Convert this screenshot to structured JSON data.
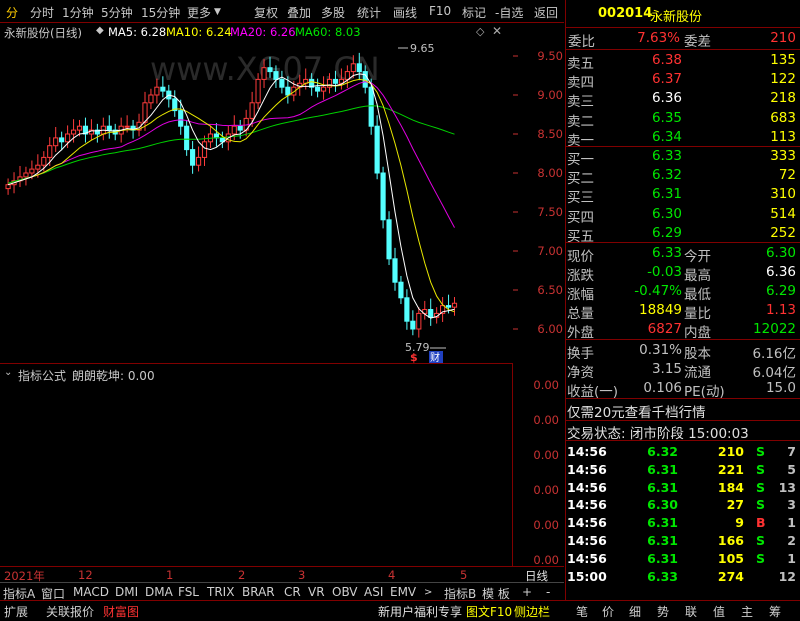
{
  "toolbar": {
    "first_glyph": "分",
    "items": [
      "分时",
      "1分钟",
      "5分钟",
      "15分钟",
      "更多"
    ],
    "right_items": [
      "复权",
      "叠加",
      "多股",
      "统计",
      "画线",
      "F10",
      "标记",
      "-自选",
      "返回"
    ]
  },
  "chart": {
    "stock_name": "永新股份(日线)",
    "ma_labels": [
      {
        "text": "MA5: 6.28",
        "color": "#ffffff"
      },
      {
        "text": "MA10: 6.24",
        "color": "#ffff00"
      },
      {
        "text": "MA20: 6.26",
        "color": "#ff00ff"
      },
      {
        "text": "MA60: 8.03",
        "color": "#00e600"
      }
    ],
    "high_marker": "9.65",
    "low_marker": "5.79",
    "event_marks": [
      "$",
      "财"
    ],
    "price_axis": [
      "9.50",
      "9.00",
      "8.50",
      "8.00",
      "7.50",
      "7.00",
      "6.50",
      "6.00"
    ],
    "indicator_title": "指标公式",
    "indicator_name": "朗朗乾坤: 0.00",
    "indicator_axis": [
      "0.00",
      "0.00",
      "0.00",
      "0.00",
      "0.00",
      "0.00"
    ],
    "dates": [
      "2021年",
      "12",
      "1",
      "2",
      "3",
      "4",
      "5"
    ],
    "period": "日线",
    "watermark": "www.XG07.CN"
  },
  "chart_data": {
    "type": "candlestick",
    "ylim": [
      5.6,
      9.75
    ],
    "ma_values": {
      "MA5": 6.28,
      "MA10": 6.24,
      "MA20": 6.26,
      "MA60": 8.03
    },
    "high": 9.65,
    "low": 5.79
  },
  "tabs": {
    "items": [
      "指标A",
      "窗口",
      "MACD",
      "DMI",
      "DMA",
      "FSL",
      "TRIX",
      "BRAR",
      "CR",
      "VR",
      "OBV",
      "ASI",
      "EMV"
    ],
    "right": [
      "指标B",
      "模 板",
      "+",
      "-"
    ]
  },
  "bottom": {
    "left": [
      "扩展",
      "关联报价",
      "财富图"
    ],
    "promo": "新用户福利专享",
    "f10": "图文F10",
    "side": "侧边栏",
    "right": [
      "笔",
      "价",
      "细",
      "势",
      "联",
      "值",
      "主",
      "筹"
    ]
  },
  "quote": {
    "code": "002014",
    "name": "永新股份",
    "weibi_label": "委比",
    "weibi": "7.63%",
    "weicha_label": "委差",
    "weicha": "210",
    "sells": [
      {
        "label": "卖五",
        "price": "6.38",
        "vol": "135"
      },
      {
        "label": "卖四",
        "price": "6.37",
        "vol": "122"
      },
      {
        "label": "卖三",
        "price": "6.36",
        "vol": "218"
      },
      {
        "label": "卖二",
        "price": "6.35",
        "vol": "683"
      },
      {
        "label": "卖一",
        "price": "6.34",
        "vol": "113"
      }
    ],
    "buys": [
      {
        "label": "买一",
        "price": "6.33",
        "vol": "333"
      },
      {
        "label": "买二",
        "price": "6.32",
        "vol": "72"
      },
      {
        "label": "买三",
        "price": "6.31",
        "vol": "310"
      },
      {
        "label": "买四",
        "price": "6.30",
        "vol": "514"
      },
      {
        "label": "买五",
        "price": "6.29",
        "vol": "252"
      }
    ],
    "stats": [
      {
        "l1": "现价",
        "v1": "6.33",
        "l2": "今开",
        "v2": "6.30"
      },
      {
        "l1": "涨跌",
        "v1": "-0.03",
        "l2": "最高",
        "v2": "6.36"
      },
      {
        "l1": "涨幅",
        "v1": "-0.47%",
        "l2": "最低",
        "v2": "6.29"
      },
      {
        "l1": "总量",
        "v1": "18849",
        "l2": "量比",
        "v2": "1.13"
      },
      {
        "l1": "外盘",
        "v1": "6827",
        "l2": "内盘",
        "v2": "12022"
      }
    ],
    "fin": [
      {
        "l1": "换手",
        "v1": "0.31%",
        "l2": "股本",
        "v2": "6.16亿"
      },
      {
        "l1": "净资",
        "v1": "3.15",
        "l2": "流通",
        "v2": "6.04亿"
      },
      {
        "l1": "收益(一)",
        "v1": "0.106",
        "l2": "PE(动)",
        "v2": "15.0"
      }
    ],
    "promo": "仅需20元查看千档行情",
    "status": "交易状态: 闭市阶段 15:00:03",
    "ticks": [
      {
        "t": "14:56",
        "p": "6.32",
        "v": "210",
        "s": "S",
        "n": "7"
      },
      {
        "t": "14:56",
        "p": "6.31",
        "v": "221",
        "s": "S",
        "n": "5"
      },
      {
        "t": "14:56",
        "p": "6.31",
        "v": "184",
        "s": "S",
        "n": "13"
      },
      {
        "t": "14:56",
        "p": "6.30",
        "v": "27",
        "s": "S",
        "n": "3"
      },
      {
        "t": "14:56",
        "p": "6.31",
        "v": "9",
        "s": "B",
        "n": "1"
      },
      {
        "t": "14:56",
        "p": "6.31",
        "v": "166",
        "s": "S",
        "n": "2"
      },
      {
        "t": "14:56",
        "p": "6.31",
        "v": "105",
        "s": "S",
        "n": "1"
      },
      {
        "t": "15:00",
        "p": "6.33",
        "v": "274",
        "s": "",
        "n": "12"
      }
    ]
  }
}
